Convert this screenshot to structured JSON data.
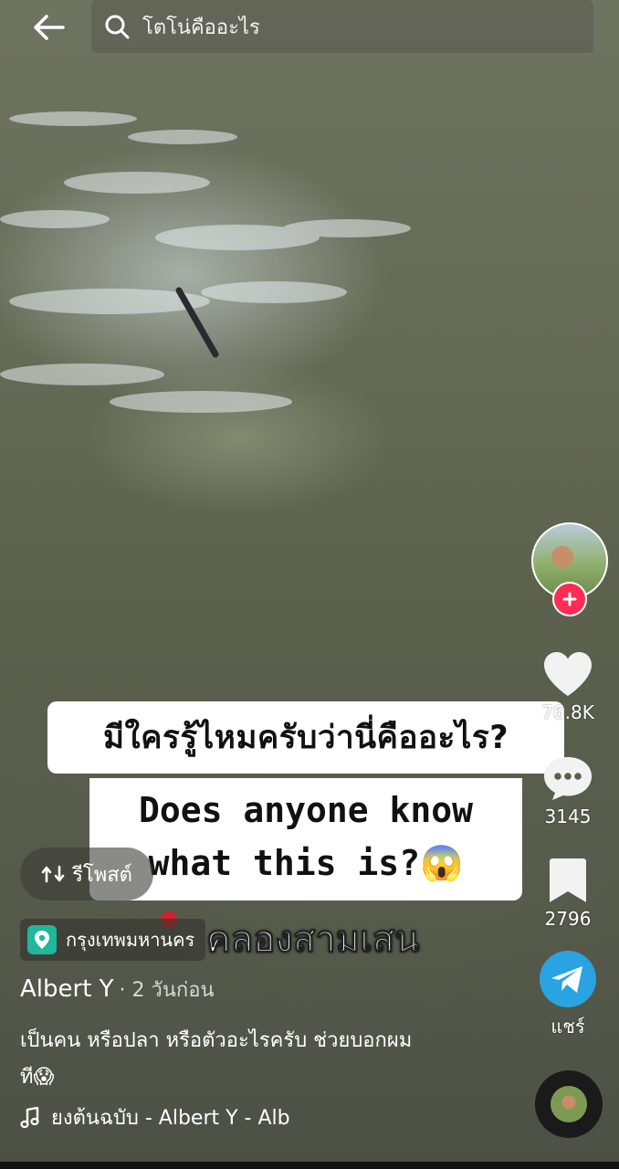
{
  "search": {
    "query": "โตโน่คืออะไร"
  },
  "caption_overlay": {
    "line_th": "มีใครรู้ไหมครับว่านี่คืออะไร?",
    "line_en_1": "Does anyone know",
    "line_en_2": "what this is?😱",
    "location_text": "คลองสามเสน"
  },
  "actions": {
    "repost_label": "รีโพสต์",
    "like_count": "76.8K",
    "comment_count": "3145",
    "bookmark_count": "2796",
    "share_label": "แชร์"
  },
  "post": {
    "location": "กรุงเทพมหานคร",
    "author": "Albert Y",
    "time_ago": "· 2 วันก่อน",
    "description_line1": "เป็นคน หรือปลา หรือตัวอะไรครับ ช่วยบอกผม",
    "description_line2": "ที😱",
    "music": "ยงต้นฉบับ - Albert Y - Alb"
  },
  "colors": {
    "follow_plus": "#fe2c55",
    "share_blue": "#2aa3e2",
    "location_green": "#1fb89a"
  }
}
